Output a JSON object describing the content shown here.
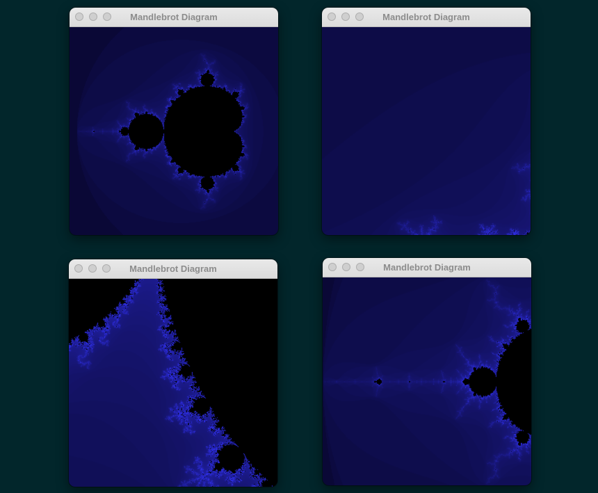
{
  "windows": [
    {
      "title": "Mandlebrot Diagram",
      "view": {
        "cx": -0.6,
        "cy": 0.0,
        "scale": 3.0
      }
    },
    {
      "title": "Mandlebrot Diagram",
      "view": {
        "cx": -0.55,
        "cy": -0.95,
        "scale": 0.6
      }
    },
    {
      "title": "Mandlebrot Diagram",
      "view": {
        "cx": -0.72,
        "cy": 0.3,
        "scale": 0.35
      }
    },
    {
      "title": "Mandlebrot Diagram",
      "view": {
        "cx": -1.55,
        "cy": 0.0,
        "scale": 0.9
      }
    }
  ],
  "colors": {
    "background": "#02262b",
    "set": "#000000",
    "far": "#04021c",
    "edge": "#3434ff"
  }
}
